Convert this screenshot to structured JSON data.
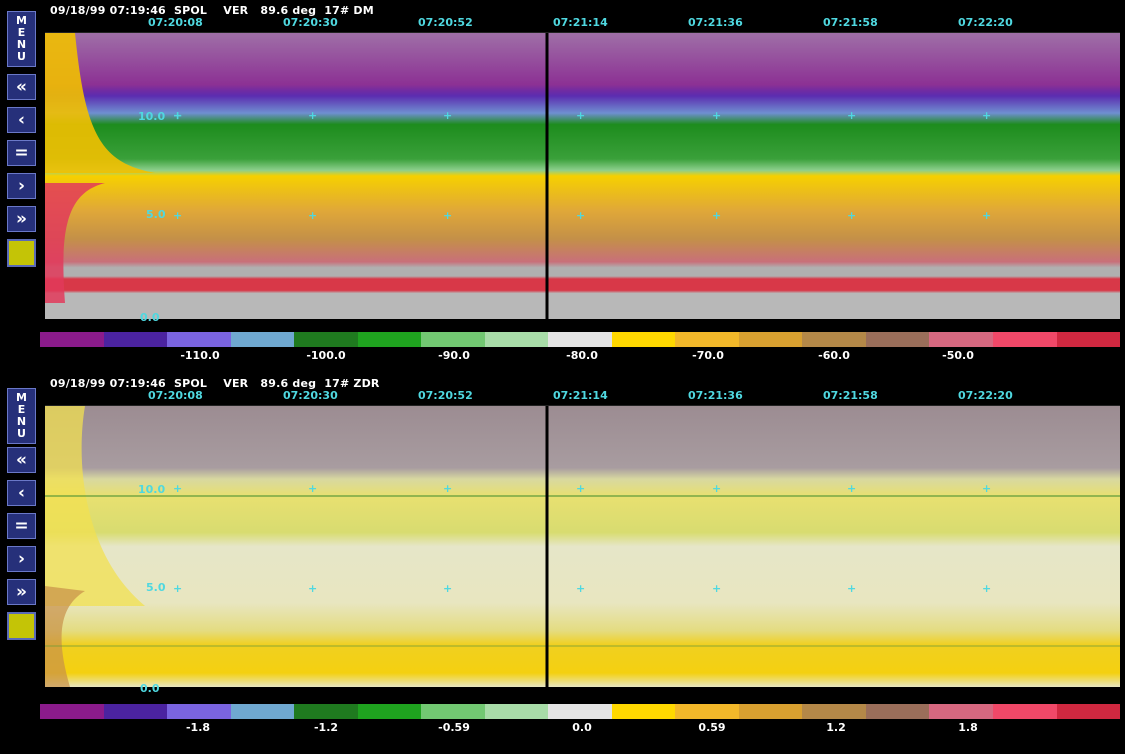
{
  "panels": [
    {
      "id": "dm",
      "header": "09/18/99 07:19:46  SPOL    VER   89.6 deg  17# DM",
      "times": [
        "07:20:08",
        "07:20:30",
        "07:20:52",
        "07:21:14",
        "07:21:36",
        "07:21:58",
        "07:22:20"
      ],
      "y_labels": [
        "10.0",
        "5.0",
        "0.0"
      ],
      "colorbar_labels": [
        "-110.0",
        "-100.0",
        "-90.0",
        "-80.0",
        "-70.0",
        "-60.0",
        "-50.0"
      ]
    },
    {
      "id": "zdr",
      "header": "09/18/99 07:19:46  SPOL    VER   89.6 deg  17# ZDR",
      "times": [
        "07:20:08",
        "07:20:30",
        "07:20:52",
        "07:21:14",
        "07:21:36",
        "07:21:58",
        "07:22:20"
      ],
      "y_labels": [
        "10.0",
        "5.0",
        "0.0"
      ],
      "colorbar_labels": [
        "-1.8",
        "-1.2",
        "-0.59",
        "0.0",
        "0.59",
        "1.2",
        "1.8"
      ]
    }
  ],
  "menu": {
    "menu_label": [
      "M",
      "E",
      "N",
      "U"
    ],
    "first": "«",
    "prev": "‹",
    "equal": "=",
    "next": "›",
    "last": "»"
  },
  "colors": {
    "palette": [
      "#8b1b8b",
      "#4b23a0",
      "#7a64e0",
      "#6fa8d0",
      "#1f7a1f",
      "#1fa31f",
      "#72c872",
      "#a8dca8",
      "#e4e4e4",
      "#ffd800",
      "#f2b82a",
      "#d8a030",
      "#b48848",
      "#9a6e5a",
      "#d66880",
      "#f04868",
      "#d02840"
    ],
    "accent_text": "#4fd8e0",
    "menu_bg": "#26307a",
    "toggle_box": "#c4c406"
  }
}
